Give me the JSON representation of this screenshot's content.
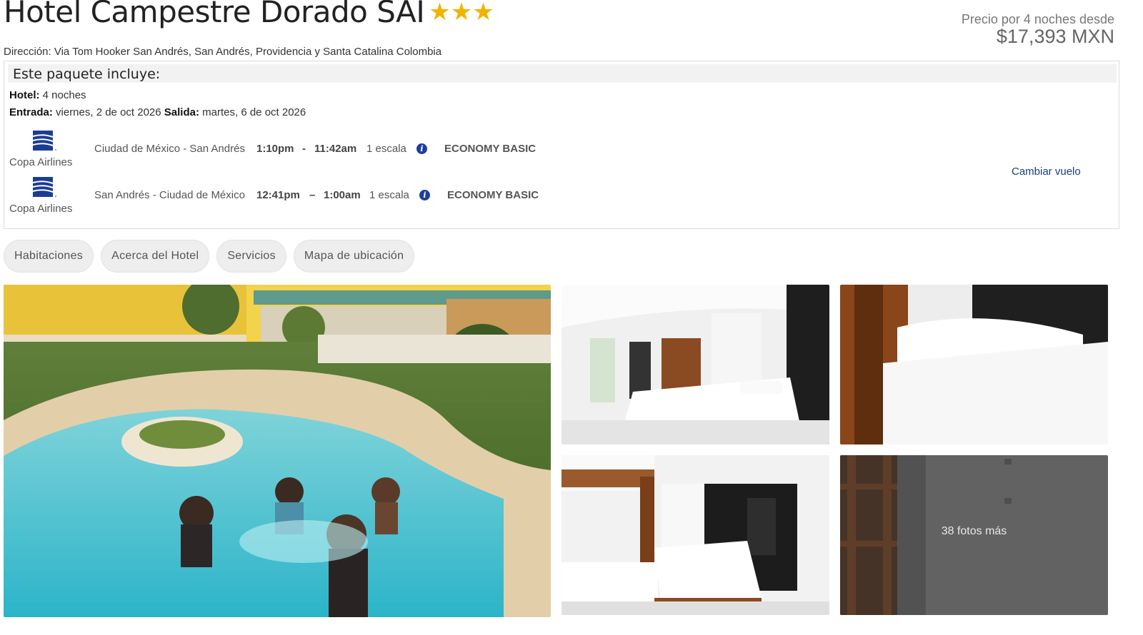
{
  "hotel": {
    "name": "Hotel Campestre Dorado SAI",
    "stars": 3,
    "star_glyph": "★",
    "address": "Dirección: Via Tom Hooker San Andrés, San Andrés, Providencia y Santa Catalina Colombia"
  },
  "price": {
    "label": "Precio por 4 noches desde",
    "value": "$17,393 MXN"
  },
  "package": {
    "title": "Este paquete incluye:",
    "hotel_label": "Hotel:",
    "hotel_value": "4 noches",
    "checkin_label": "Entrada:",
    "checkin_value": "viernes, 2 de oct 2026",
    "checkout_label": "Salida:",
    "checkout_value": "martes, 6 de oct 2026",
    "flights": [
      {
        "airline": "Copa Airlines",
        "route": "Ciudad de México - San Andrés",
        "depart": "1:10pm",
        "separator": "-",
        "arrive": "11:42am",
        "stops": "1 escala",
        "cabin": "ECONOMY BASIC"
      },
      {
        "airline": "Copa Airlines",
        "route": "San Andrés - Ciudad de México",
        "depart": "12:41pm",
        "separator": "–",
        "arrive": "1:00am",
        "stops": "1 escala",
        "cabin": "ECONOMY BASIC"
      }
    ],
    "change_flight": "Cambiar vuelo"
  },
  "tabs": [
    {
      "label": "Habitaciones"
    },
    {
      "label": "Acerca del Hotel"
    },
    {
      "label": "Servicios"
    },
    {
      "label": "Mapa de ubicación"
    }
  ],
  "gallery": {
    "more_photos": "38 fotos más"
  },
  "colors": {
    "star": "#f0b400",
    "link": "#1a3f7a",
    "info_icon": "#1e3e9e",
    "airline_logo": "#1b3d93"
  }
}
